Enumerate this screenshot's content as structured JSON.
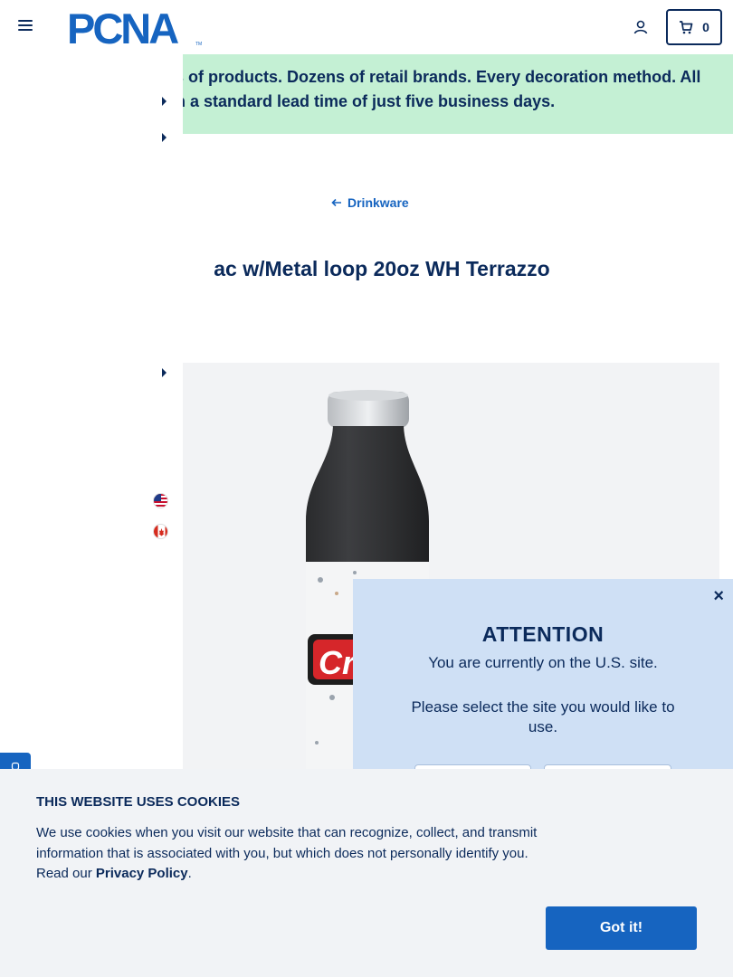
{
  "header": {
    "logo_text": "PCNA",
    "logo_tm": "TM",
    "cart_count": "0"
  },
  "banner": {
    "line1": "ls of products. Dozens of retail brands. Every decoration method. All",
    "line2": "th a standard lead time of just five business days."
  },
  "breadcrumb": {
    "label": "Drinkware"
  },
  "product": {
    "title": "ac w/Metal loop 20oz WH Terrazzo",
    "decoration_text": "Cr"
  },
  "attention": {
    "title": "ATTENTION",
    "message": "You are currently on the U.S. site.",
    "prompt": "Please select the site you would like to use.",
    "close": "×"
  },
  "cookie": {
    "title": "THIS WEBSITE USES COOKIES",
    "text_before": "We use cookies when you visit our website that can recognize, collect, and transmit information that is associated with you, but which does not personally identify you. Read our ",
    "link": "Privacy Policy",
    "text_after": ".",
    "button": "Got it!"
  },
  "colors": {
    "navy": "#0b2a5b",
    "accent_blue": "#1664c0",
    "banner_green": "#c4f0d4",
    "modal_blue": "#cfe0f5"
  },
  "icons": [
    "menu-icon",
    "account-icon",
    "cart-icon",
    "arrow-left-icon",
    "us-flag-icon",
    "canada-flag-icon",
    "chat-icon",
    "close-icon"
  ]
}
